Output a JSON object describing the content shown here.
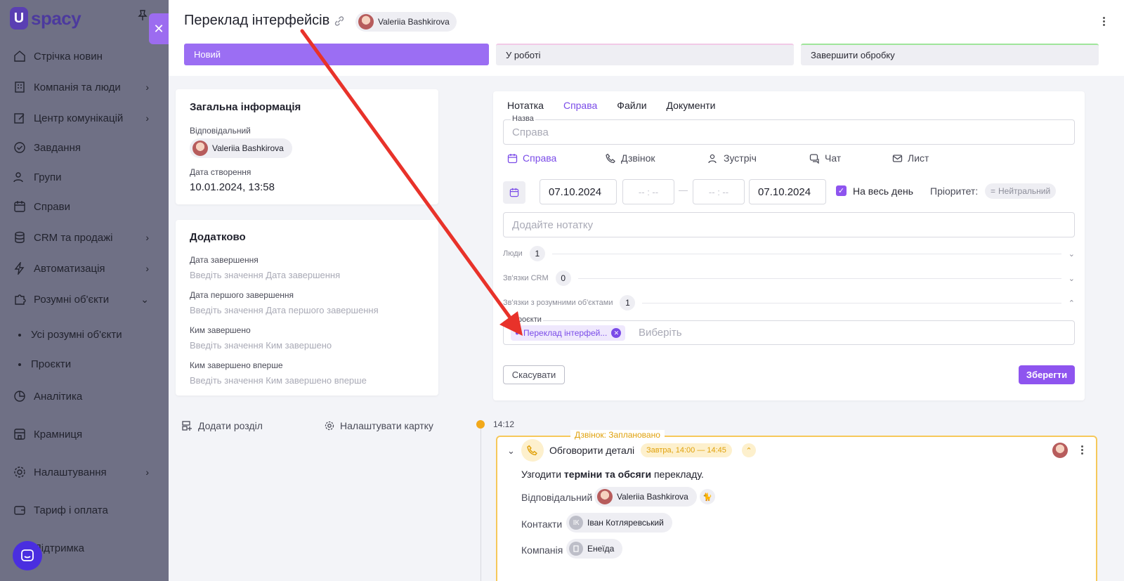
{
  "sidebar": {
    "logo": "spacy",
    "items": [
      {
        "label": "Стрічка новин"
      },
      {
        "label": "Компанія та люди"
      },
      {
        "label": "Центр комунікацій"
      },
      {
        "label": "Завдання"
      },
      {
        "label": "Групи"
      },
      {
        "label": "Справи"
      },
      {
        "label": "CRM та продажі"
      },
      {
        "label": "Автоматизація"
      },
      {
        "label": "Розумні об'єкти"
      },
      {
        "label": "Усі розумні об'єкти"
      },
      {
        "label": "Проєкти"
      },
      {
        "label": "Аналітика"
      },
      {
        "label": "Крамниця"
      },
      {
        "label": "Налаштування"
      },
      {
        "label": "Тариф і оплата"
      },
      {
        "label": "Підтримка"
      }
    ]
  },
  "header": {
    "title": "Переклад інтерфейсів",
    "owner": "Valeriia Bashkirova",
    "stages": [
      "Новий",
      "У роботі",
      "Завершити обробку"
    ]
  },
  "general": {
    "heading": "Загальна інформація",
    "responsible_label": "Відповідальний",
    "responsible": "Valeriia Bashkirova",
    "created_label": "Дата створення",
    "created": "10.01.2024, 13:58"
  },
  "extra": {
    "heading": "Додатково",
    "fields": [
      {
        "label": "Дата завершення",
        "placeholder": "Введіть значення Дата завершення"
      },
      {
        "label": "Дата першого завершення",
        "placeholder": "Введіть значення Дата першого завершення"
      },
      {
        "label": "Ким завершено",
        "placeholder": "Введіть значення Ким завершено"
      },
      {
        "label": "Ким завершено вперше",
        "placeholder": "Введіть значення Ким завершено вперше"
      }
    ]
  },
  "bottom_links": {
    "add_section": "Додати розділ",
    "configure_card": "Налаштувати картку"
  },
  "activity": {
    "tabs": [
      "Нотатка",
      "Справа",
      "Файли",
      "Документи"
    ],
    "name_label": "Назва",
    "name_placeholder": "Справа",
    "types": [
      "Справа",
      "Дзвінок",
      "Зустріч",
      "Чат",
      "Лист"
    ],
    "date_from": "07.10.2024",
    "time_placeholder": "-- : --",
    "dash": "—",
    "date_to": "07.10.2024",
    "all_day": "На весь день",
    "priority_label": "Пріоритет:",
    "priority": "Нейтральний",
    "note_placeholder": "Додайте нотатку",
    "people_label": "Люди",
    "people_count": "1",
    "crm_label": "Зв'язки CRM",
    "crm_count": "0",
    "smart_label": "Зв'язки з розумними об'єктами",
    "smart_count": "1",
    "projects_label": "Проєкти",
    "project_chip": "Переклад інтерфей...",
    "select_placeholder": "Виберіть",
    "cancel": "Скасувати",
    "save": "Зберегти"
  },
  "timeline": {
    "time": "14:12",
    "status": "Дзвінок: Заплановано",
    "subject": "Обговорити деталі",
    "when": "Завтра, 14:00 — 14:45",
    "desc_prefix": "Узгодити ",
    "desc_bold": "терміни та обсяги",
    "desc_suffix": " перекладу.",
    "responsible_label": "Відповідальний",
    "responsible": "Valeriia Bashkirova",
    "contacts_label": "Контакти",
    "contact_initials": "ІК",
    "contact": "Іван Котляревський",
    "company_label": "Компанія",
    "company": "Енеїда"
  },
  "colors": {
    "accent": "#8e54ef",
    "warning": "#f2a91b",
    "arrow": "#e8322a"
  }
}
